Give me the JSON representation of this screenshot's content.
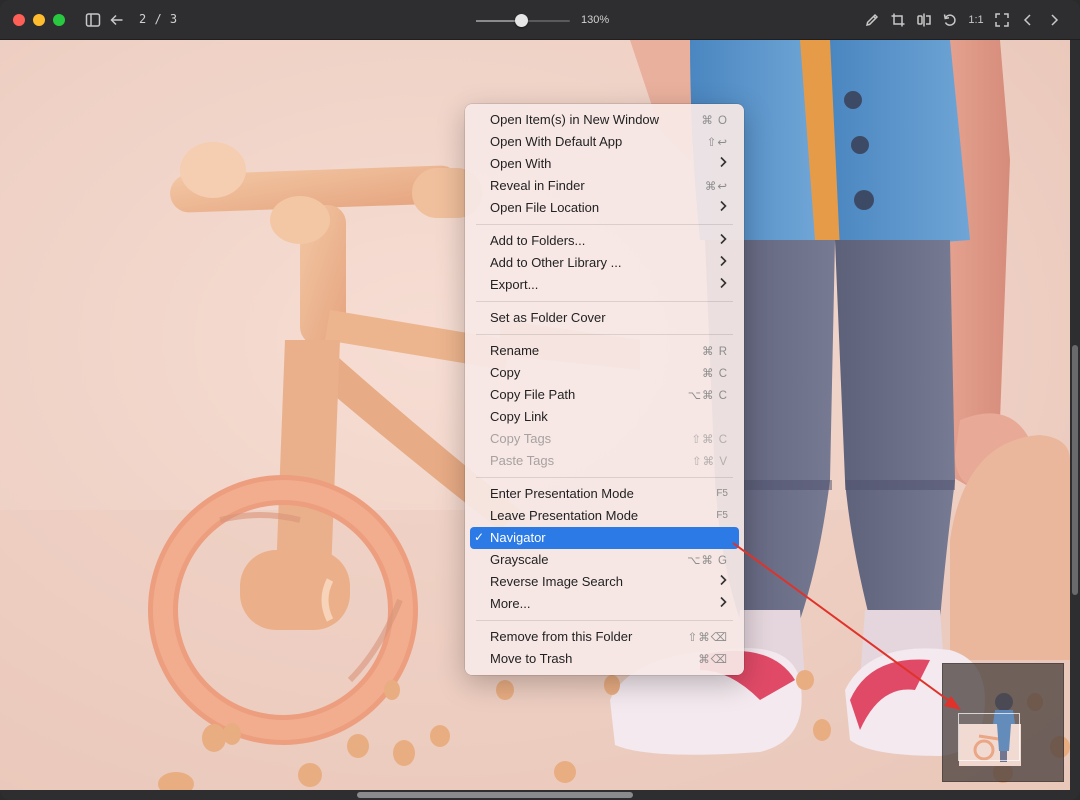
{
  "toolbar": {
    "page_counter": "2 / 3",
    "zoom_label": "130%",
    "zoom_level_fraction": 0.48,
    "actual_size_label": "1:1"
  },
  "context_menu": {
    "groups": [
      [
        {
          "label": "Open Item(s) in New Window",
          "shortcut": "⌘ O"
        },
        {
          "label": "Open With Default App",
          "shortcut": "⇧↩"
        },
        {
          "label": "Open With",
          "submenu": true
        },
        {
          "label": "Reveal in Finder",
          "shortcut": "⌘↩"
        },
        {
          "label": "Open File Location",
          "submenu": true
        }
      ],
      [
        {
          "label": "Add to Folders...",
          "submenu": true
        },
        {
          "label": "Add to Other Library ...",
          "submenu": true
        },
        {
          "label": "Export...",
          "submenu": true
        }
      ],
      [
        {
          "label": "Set as Folder Cover"
        }
      ],
      [
        {
          "label": "Rename",
          "shortcut": "⌘ R"
        },
        {
          "label": "Copy",
          "shortcut": "⌘ C"
        },
        {
          "label": "Copy File Path",
          "shortcut": "⌥⌘ C"
        },
        {
          "label": "Copy Link"
        },
        {
          "label": "Copy Tags",
          "shortcut": "⇧⌘ C",
          "disabled": true
        },
        {
          "label": "Paste Tags",
          "shortcut": "⇧⌘ V",
          "disabled": true
        }
      ],
      [
        {
          "label": "Enter Presentation Mode",
          "shortcut": "F5",
          "small": true
        },
        {
          "label": "Leave Presentation Mode",
          "shortcut": "F5",
          "small": true
        },
        {
          "label": "Navigator",
          "checked": true,
          "highlighted": true,
          "check_mark": "✓"
        },
        {
          "label": "Grayscale",
          "shortcut": "⌥⌘ G"
        },
        {
          "label": "Reverse Image Search",
          "submenu": true
        },
        {
          "label": "More...",
          "submenu": true
        }
      ],
      [
        {
          "label": "Remove from this Folder",
          "shortcut": "⇧⌘⌫"
        },
        {
          "label": "Move to Trash",
          "shortcut": "⌘⌫"
        }
      ]
    ]
  },
  "colors": {
    "accent": "#2b7ae6",
    "annotation_arrow": "#e0322a",
    "close": "#fe5f57",
    "minimize": "#febc2e",
    "maximize": "#28c840"
  },
  "icons": [
    "sidebar-icon",
    "back-arrow-icon",
    "pencil-icon",
    "crop-icon",
    "flip-icon",
    "rotate-icon",
    "fullscreen-icon",
    "chevron-left-icon",
    "chevron-right-icon"
  ]
}
